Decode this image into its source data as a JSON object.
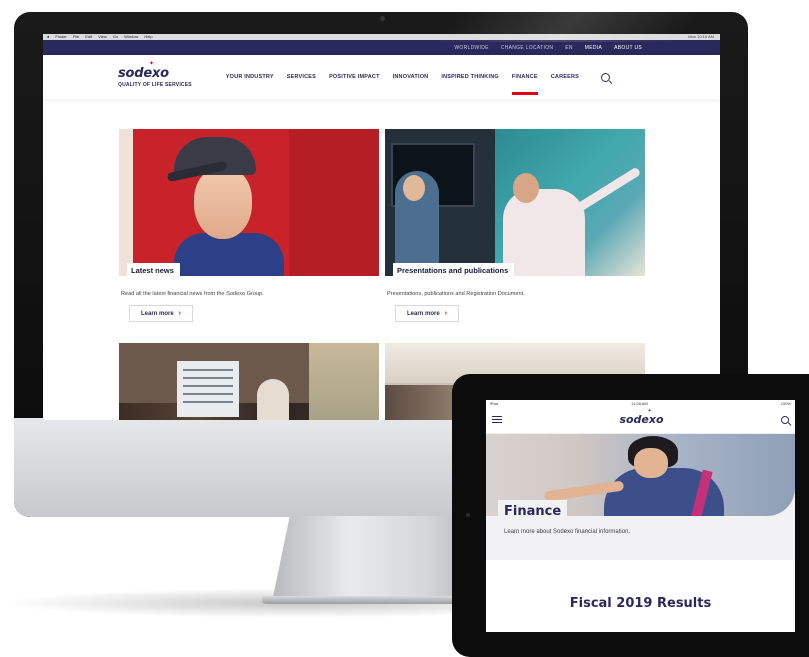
{
  "mac_menubar": {
    "apple": "",
    "items": [
      "Finder",
      "File",
      "Edit",
      "View",
      "Go",
      "Window",
      "Help"
    ],
    "status": "Mon 10:15 AM"
  },
  "utility_nav": {
    "worldwide": "WORLDWIDE",
    "change_location": "CHANGE LOCATION",
    "language": "EN",
    "media": "MEDIA",
    "about": "ABOUT US"
  },
  "brand": {
    "logo_text": "sodexo",
    "tagline": "QUALITY OF LIFE SERVICES",
    "colors": {
      "navy": "#2a295c",
      "red": "#e1001a"
    }
  },
  "main_nav": {
    "items": [
      "YOUR INDUSTRY",
      "SERVICES",
      "POSITIVE IMPACT",
      "INNOVATION",
      "INSPIRED THINKING",
      "FINANCE",
      "CAREERS"
    ],
    "active": "FINANCE",
    "search_icon": "search-icon"
  },
  "cards": [
    {
      "label": "Latest news",
      "description": "Read all the latest financial news from the Sodexo Group.",
      "button": "Learn more"
    },
    {
      "label": "Presentations and publications",
      "description": "Presentations, publications and Registration Document.",
      "button": "Learn more"
    }
  ],
  "ipad": {
    "status_left": "iPad",
    "status_center": "11:28 AM",
    "status_right": "100%",
    "logo_text": "sodexo",
    "hero_title": "Finance",
    "hero_subtitle": "Learn more about Sodexo financial information.",
    "section_title": "Fiscal 2019 Results"
  }
}
